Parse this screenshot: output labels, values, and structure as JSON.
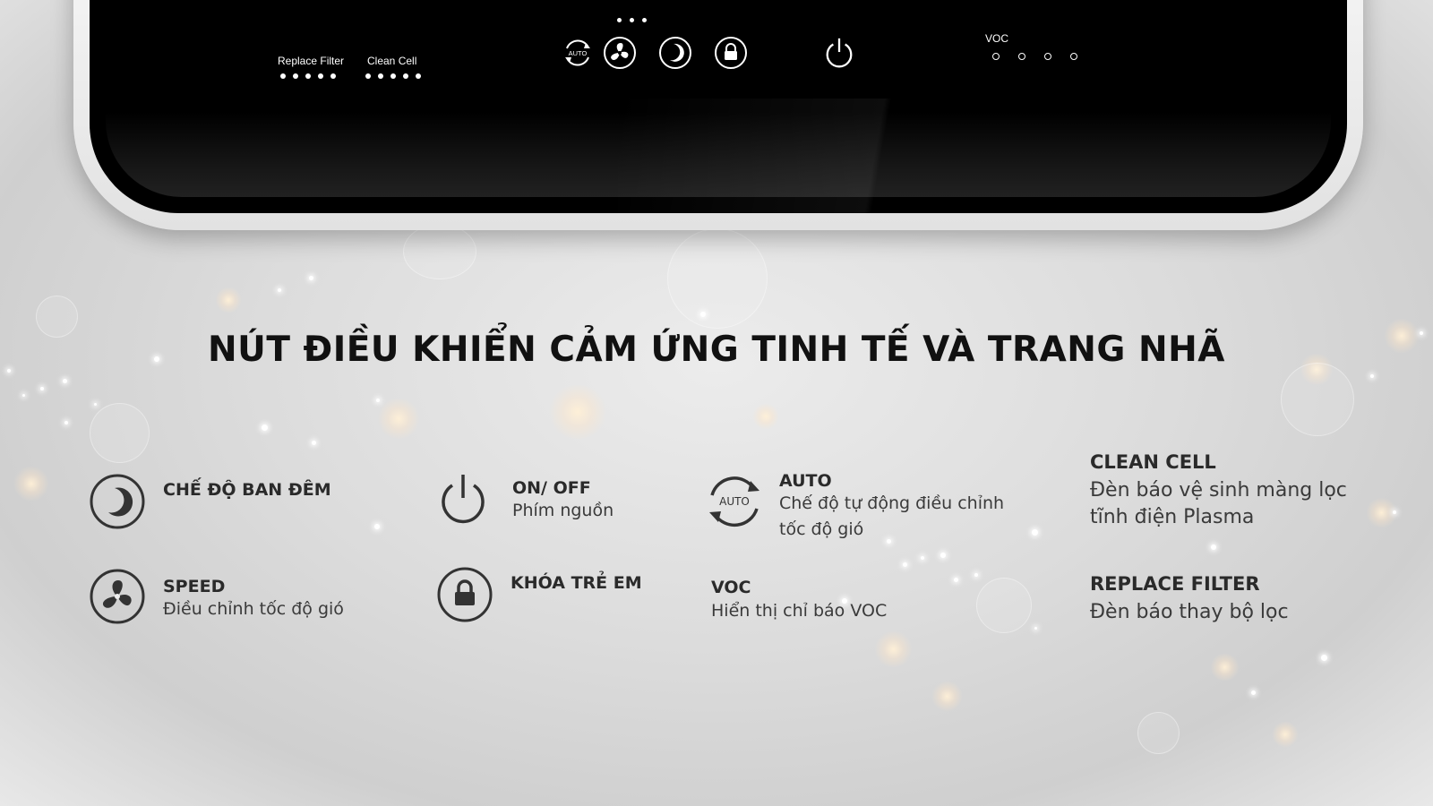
{
  "device": {
    "replace_filter_label": "Replace Filter",
    "clean_cell_label": "Clean Cell",
    "auto_button_text": "AUTO",
    "voc_label": "VOC",
    "buttons": [
      "auto-icon",
      "fan-icon",
      "moon-icon",
      "lock-icon",
      "power-icon"
    ]
  },
  "headline": "NÚT ĐIỀU KHIỂN CẢM ỨNG TINH TẾ VÀ TRANG NHÃ",
  "features": {
    "night": {
      "title": "CHẾ ĐỘ BAN ĐÊM",
      "icon": "moon-icon"
    },
    "speed": {
      "title": "SPEED",
      "desc": "Điều chỉnh tốc độ gió",
      "icon": "fan-icon"
    },
    "onoff": {
      "title": "ON/ OFF",
      "desc": "Phím nguồn",
      "icon": "power-icon"
    },
    "childlock": {
      "title": "KHÓA TRẺ EM",
      "icon": "lock-icon"
    },
    "auto": {
      "title": "AUTO",
      "desc_line1": "Chế độ tự động điều chỉnh",
      "desc_line2": "tốc độ gió",
      "icon_text": "AUTO",
      "icon": "auto-icon"
    },
    "voc": {
      "title": "VOC",
      "desc": "Hiển thị chỉ báo VOC"
    },
    "clean_cell": {
      "title": "CLEAN CELL",
      "desc_line1": "Đèn báo vệ sinh màng lọc",
      "desc_line2": "tĩnh điện Plasma"
    },
    "replace_filter": {
      "title": "REPLACE FILTER",
      "desc": "Đèn báo thay bộ lọc"
    }
  },
  "colors": {
    "panel": "#000000",
    "rim": "#eeeeee",
    "text": "#222222",
    "background": "#dcdcdc"
  }
}
